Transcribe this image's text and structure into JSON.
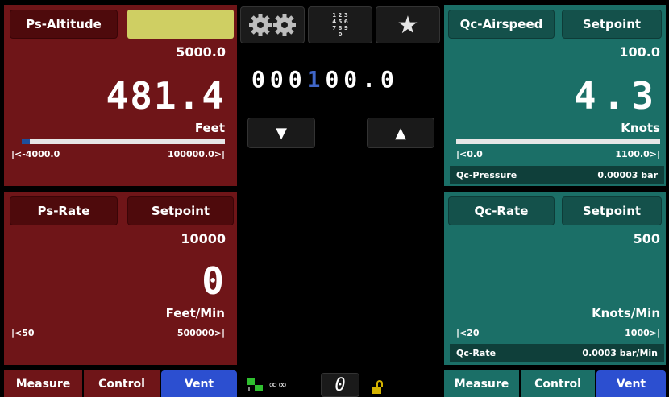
{
  "left_top": {
    "title_button": "Ps-Altitude",
    "setpoint_value": "5000.0",
    "reading": "481.4",
    "unit": "Feet",
    "range_min": "|<-4000.0",
    "range_max": "100000.0>|",
    "bar_fraction": 0.04
  },
  "left_bottom": {
    "title_button": "Ps-Rate",
    "setpoint_button": "Setpoint",
    "setpoint_value": "10000",
    "reading": "0",
    "unit": "Feet/Min",
    "range_min": "|<50",
    "range_max": "500000>|"
  },
  "middle": {
    "entry_digits_left": "000",
    "entry_digit_highlight": "1",
    "entry_digits_right": "00.0",
    "keypad_icon_text": "1 2 3\n4 5 6\n7 8 9\n0"
  },
  "right_top": {
    "title_button": "Qc-Airspeed",
    "setpoint_button": "Setpoint",
    "setpoint_value": "100.0",
    "reading": "4.3",
    "unit": "Knots",
    "range_min": "|<0.0",
    "range_max": "1100.0>|",
    "info_label": "Qc-Pressure",
    "info_value": "0.00003 bar"
  },
  "right_bottom": {
    "title_button": "Qc-Rate",
    "setpoint_button": "Setpoint",
    "setpoint_value": "500",
    "unit": "Knots/Min",
    "range_min": "|<20",
    "range_max": "1000>|",
    "info_label": "Qc-Rate",
    "info_value": "0.0003 bar/Min"
  },
  "bottom_left_tabs": {
    "measure": "Measure",
    "control": "Control",
    "vent": "Vent"
  },
  "bottom_right_tabs": {
    "measure": "Measure",
    "control": "Control",
    "vent": "Vent"
  },
  "status_bar": {
    "zero_label": "0"
  },
  "colors": {
    "red_panel": "#6f1518",
    "teal_panel": "#1b6f67",
    "vent_blue": "#2c4fd0",
    "setpoint_yellow": "#cfcf63",
    "bar_blue": "#1d4f9c"
  }
}
